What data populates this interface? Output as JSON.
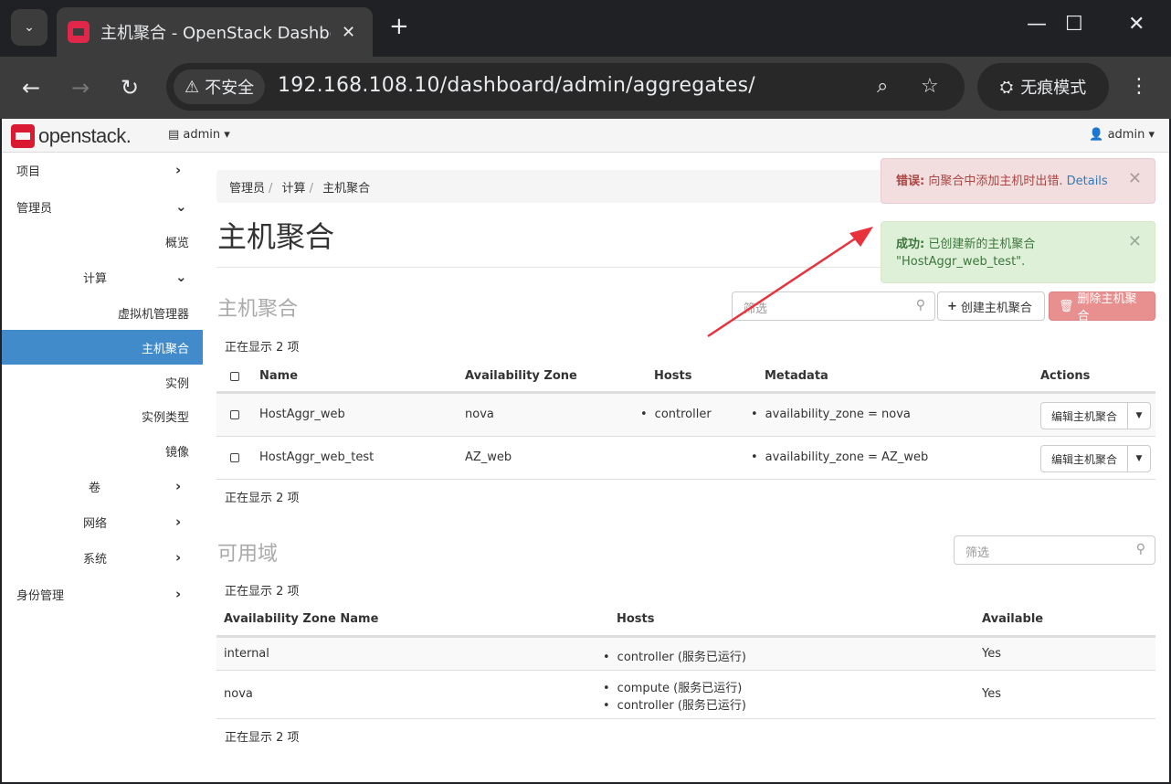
{
  "browser": {
    "tab_title": "主机聚合 - OpenStack Dashboard",
    "tab_close": "✕",
    "new_tab": "+",
    "secure_label": "不安全",
    "url": "192.168.108.10/dashboard/admin/aggregates/",
    "incognito_label": "无痕模式"
  },
  "topnav": {
    "logo_text": "openstack.",
    "project_label": "admin",
    "user_label": "admin"
  },
  "sidebar": {
    "items": [
      {
        "label": "项目"
      },
      {
        "label": "管理员"
      },
      {
        "label": "概览"
      },
      {
        "label": "计算"
      },
      {
        "label": "虚拟机管理器"
      },
      {
        "label": "主机聚合"
      },
      {
        "label": "实例"
      },
      {
        "label": "实例类型"
      },
      {
        "label": "镜像"
      },
      {
        "label": "卷"
      },
      {
        "label": "网络"
      },
      {
        "label": "系统"
      },
      {
        "label": "身份管理"
      }
    ]
  },
  "breadcrumb": [
    "管理员",
    "计算",
    "主机聚合"
  ],
  "page_title": "主机聚合",
  "alerts": {
    "error": {
      "prefix": "错误:",
      "message": "向聚合中添加主机时出错.",
      "link": "Details"
    },
    "success": {
      "prefix": "成功:",
      "message": "已创建新的主机聚合 \"HostAggr_web_test\"."
    }
  },
  "aggregates": {
    "heading": "主机聚合",
    "filter_placeholder": "筛选",
    "create_button": "创建主机聚合",
    "delete_button": "删除主机聚合",
    "count_text": "正在显示 2 项",
    "columns": [
      "Name",
      "Availability Zone",
      "Hosts",
      "Metadata",
      "Actions"
    ],
    "rows": [
      {
        "name": "HostAggr_web",
        "zone": "nova",
        "hosts": "controller",
        "metadata": "availability_zone = nova",
        "action": "编辑主机聚合"
      },
      {
        "name": "HostAggr_web_test",
        "zone": "AZ_web",
        "hosts": "",
        "metadata": "availability_zone = AZ_web",
        "action": "编辑主机聚合"
      }
    ]
  },
  "zones": {
    "heading": "可用域",
    "filter_placeholder": "筛选",
    "count_text": "正在显示 2 项",
    "columns": [
      "Availability Zone Name",
      "Hosts",
      "Available"
    ],
    "rows": [
      {
        "name": "internal",
        "hosts": [
          "controller (服务已运行)"
        ],
        "available": "Yes"
      },
      {
        "name": "nova",
        "hosts": [
          "compute (服务已运行)",
          "controller (服务已运行)"
        ],
        "available": "Yes"
      }
    ]
  },
  "colors": {
    "accent": "#428bca",
    "danger": "#e8908f",
    "annotation_arrow": "#e8323c"
  }
}
